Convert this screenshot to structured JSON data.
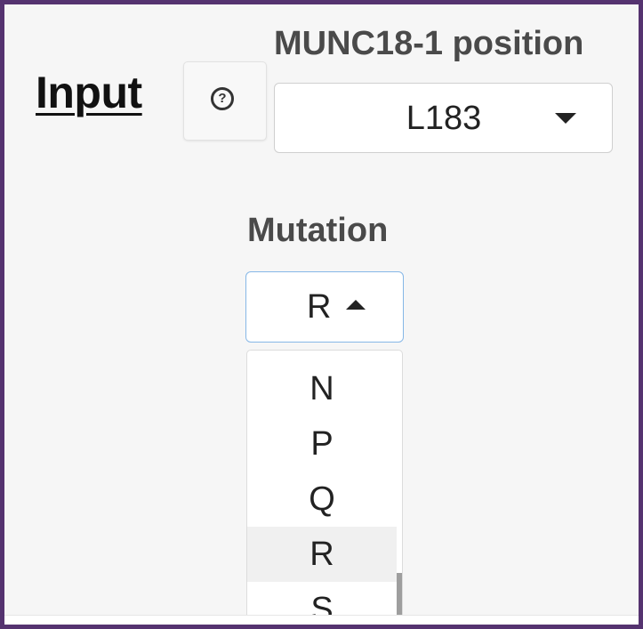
{
  "input_section": {
    "heading": "Input",
    "help_button": {
      "icon": "question-circle-icon",
      "glyph": "?"
    }
  },
  "position_field": {
    "label": "MUNC18-1 position",
    "value": "L183"
  },
  "mutation_field": {
    "label": "Mutation",
    "value": "R",
    "expanded": true,
    "visible_options": [
      {
        "label": "N"
      },
      {
        "label": "P"
      },
      {
        "label": "Q"
      },
      {
        "label": "R"
      },
      {
        "label": "S"
      }
    ],
    "highlighted_option": "R"
  },
  "colors": {
    "border_frame": "#553370",
    "focus_border": "#86b7e7",
    "label_text": "#4a4a4a",
    "highlight_row": "#f0f0f0"
  }
}
